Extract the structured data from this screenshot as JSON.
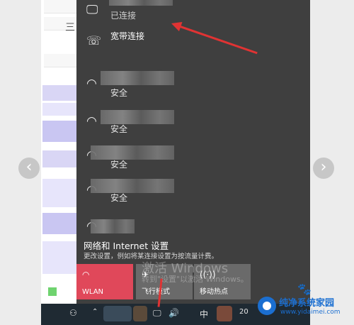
{
  "carousel": {
    "prev_glyph": "‹",
    "next_glyph": "›"
  },
  "background_page": {
    "menu_glyph": "三"
  },
  "network_flyout": {
    "connected_item": {
      "status": "已连接",
      "icon": "monitor-icon"
    },
    "broadband": {
      "label": "宽带连接",
      "icon": "dialup-icon"
    },
    "wifi_networks": [
      {
        "status": "安全",
        "icon": "wifi-icon"
      },
      {
        "status": "安全",
        "icon": "wifi-icon"
      },
      {
        "status": "安全",
        "icon": "wifi-icon"
      },
      {
        "status": "安全",
        "icon": "wifi-icon"
      },
      {
        "status": "",
        "icon": "wifi-icon"
      }
    ],
    "settings": {
      "title": "网络和 Internet 设置",
      "subtitle": "更改设置，例如将某连接设置为按流量计费。"
    },
    "quick_actions": [
      {
        "label": "WLAN",
        "icon": "wifi-icon",
        "active": true
      },
      {
        "label": "飞行模式",
        "icon": "airplane-icon",
        "active": false
      },
      {
        "label": "移动热点",
        "icon": "hotspot-icon",
        "active": false
      }
    ],
    "accent_color": "#e0485a",
    "panel_color": "#3f3f3f"
  },
  "watermark": {
    "line1": "激活 Windows",
    "line2": "转到\"设置\"以激活 Windows。"
  },
  "taskbar": {
    "ime": "中",
    "clock_partial": "20"
  },
  "brand": {
    "name": "纯净系统家园",
    "url": "www.yidaimei.com"
  }
}
